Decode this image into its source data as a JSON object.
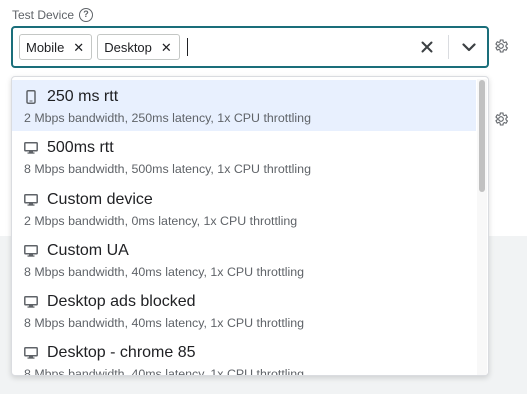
{
  "field": {
    "label": "Test Device",
    "help_icon": "help-circle-icon",
    "chips": [
      {
        "label": "Mobile",
        "remove_icon": "close-icon"
      },
      {
        "label": "Desktop",
        "remove_icon": "close-icon"
      }
    ],
    "clear_icon": "close-icon",
    "dropdown_icon": "chevron-down-icon",
    "accent_color": "#1a6e7a"
  },
  "side_icons": [
    "gear-icon",
    "gear-icon"
  ],
  "options": [
    {
      "icon": "mobile-icon",
      "title": "250 ms rtt",
      "subtitle": "2 Mbps bandwidth, 250ms latency, 1x CPU throttling",
      "highlighted": true
    },
    {
      "icon": "desktop-icon",
      "title": "500ms rtt",
      "subtitle": "8 Mbps bandwidth, 500ms latency, 1x CPU throttling"
    },
    {
      "icon": "desktop-icon",
      "title": "Custom device",
      "subtitle": "2 Mbps bandwidth, 0ms latency, 1x CPU throttling"
    },
    {
      "icon": "desktop-icon",
      "title": "Custom UA",
      "subtitle": "8 Mbps bandwidth, 40ms latency, 1x CPU throttling"
    },
    {
      "icon": "desktop-icon",
      "title": "Desktop ads blocked",
      "subtitle": "8 Mbps bandwidth, 40ms latency, 1x CPU throttling"
    },
    {
      "icon": "desktop-icon",
      "title": "Desktop - chrome 85",
      "subtitle": "8 Mbps bandwidth, 40ms latency, 1x CPU throttling"
    }
  ]
}
